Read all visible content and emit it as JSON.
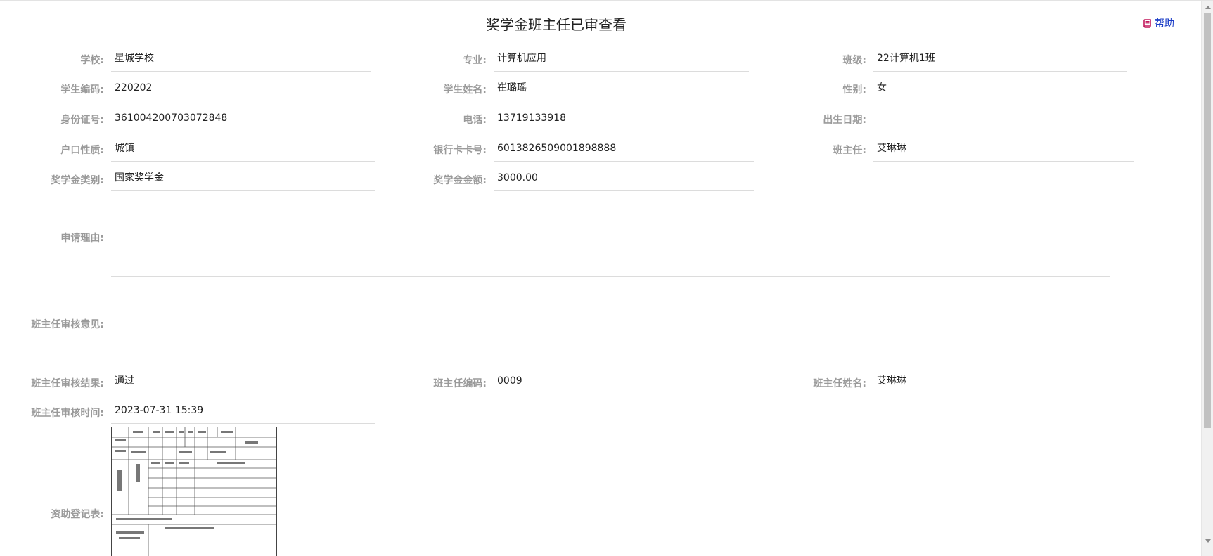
{
  "header": {
    "title": "奖学金班主任已审查看",
    "help_label": "帮助"
  },
  "fields": {
    "school": {
      "label": "学校:",
      "value": "星城学校"
    },
    "major": {
      "label": "专业:",
      "value": "计算机应用"
    },
    "class": {
      "label": "班级:",
      "value": "22计算机1班"
    },
    "student_code": {
      "label": "学生编码:",
      "value": "220202"
    },
    "student_name": {
      "label": "学生姓名:",
      "value": "崔璐瑶"
    },
    "gender": {
      "label": "性别:",
      "value": "女"
    },
    "id_number": {
      "label": "身份证号:",
      "value": "361004200703072848"
    },
    "phone": {
      "label": "电话:",
      "value": "13719133918"
    },
    "birth_date": {
      "label": "出生日期:",
      "value": ""
    },
    "household": {
      "label": "户口性质:",
      "value": "城镇"
    },
    "bank_card": {
      "label": "银行卡卡号:",
      "value": "6013826509001898888"
    },
    "head_teacher": {
      "label": "班主任:",
      "value": "艾琳琳"
    },
    "scholarship_type": {
      "label": "奖学金类别:",
      "value": "国家奖学金"
    },
    "scholarship_amount": {
      "label": "奖学金金额:",
      "value": "3000.00"
    },
    "reason": {
      "label": "申请理由:",
      "value": ""
    },
    "teacher_opinion": {
      "label": "班主任审核意见:",
      "value": ""
    },
    "review_result": {
      "label": "班主任审核结果:",
      "value": "通过"
    },
    "teacher_code": {
      "label": "班主任编码:",
      "value": "0009"
    },
    "teacher_name": {
      "label": "班主任姓名:",
      "value": "艾琳琳"
    },
    "review_time": {
      "label": "班主任审核时间:",
      "value": "2023-07-31 15:39"
    },
    "aid_form": {
      "label": "资助登记表:"
    }
  },
  "icons": {
    "help": "book-icon"
  },
  "colors": {
    "help_link": "#1a3cc7",
    "help_icon": "#c2185b",
    "label": "#9a9a9a"
  }
}
